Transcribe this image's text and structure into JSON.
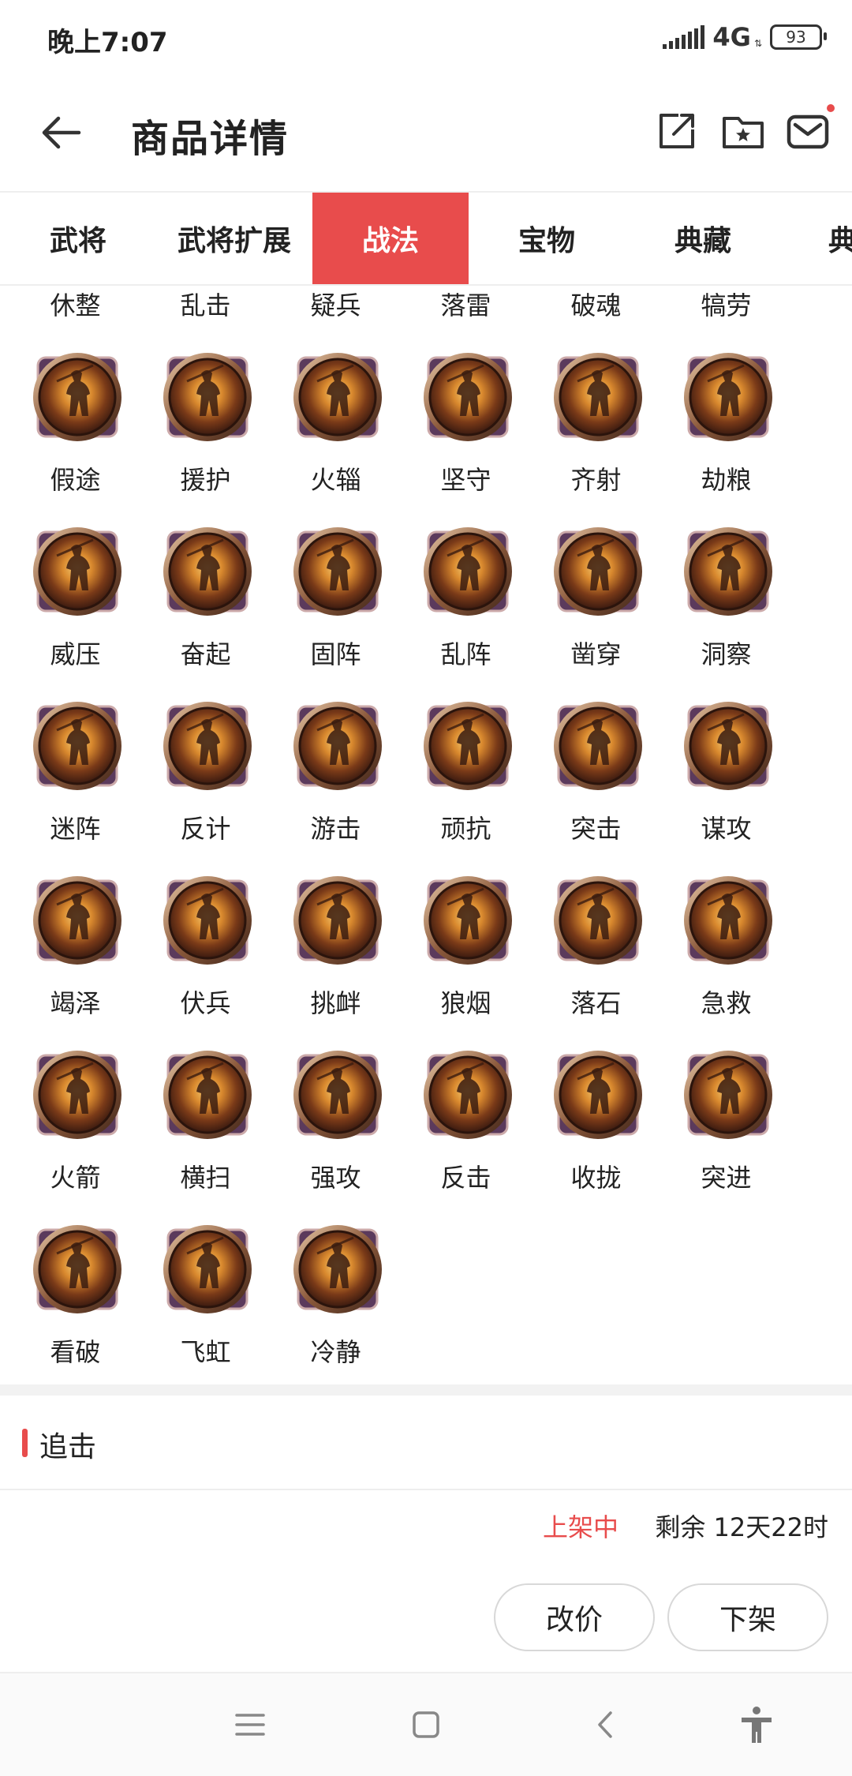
{
  "status_bar": {
    "time": "晚上7:07",
    "network": "4G",
    "battery": "93"
  },
  "header": {
    "title": "商品详情"
  },
  "tabs": [
    {
      "label": "武将"
    },
    {
      "label": "武将扩展"
    },
    {
      "label": "战法",
      "active": true
    },
    {
      "label": "宝物"
    },
    {
      "label": "典藏"
    },
    {
      "label": "典"
    }
  ],
  "skills": [
    "休整",
    "乱击",
    "疑兵",
    "落雷",
    "破魂",
    "犒劳",
    "假途",
    "援护",
    "火辎",
    "坚守",
    "齐射",
    "劫粮",
    "威压",
    "奋起",
    "固阵",
    "乱阵",
    "凿穿",
    "洞察",
    "迷阵",
    "反计",
    "游击",
    "顽抗",
    "突击",
    "谋攻",
    "竭泽",
    "伏兵",
    "挑衅",
    "狼烟",
    "落石",
    "急救",
    "火箭",
    "横扫",
    "强攻",
    "反击",
    "收拢",
    "突进",
    "看破",
    "飞虹",
    "冷静"
  ],
  "section": {
    "title": "追击"
  },
  "listing": {
    "status": "上架中",
    "remaining": "剩余  12天22时"
  },
  "actions": {
    "reprice": "改价",
    "delist": "下架"
  },
  "colors": {
    "accent": "#e84c4c"
  }
}
